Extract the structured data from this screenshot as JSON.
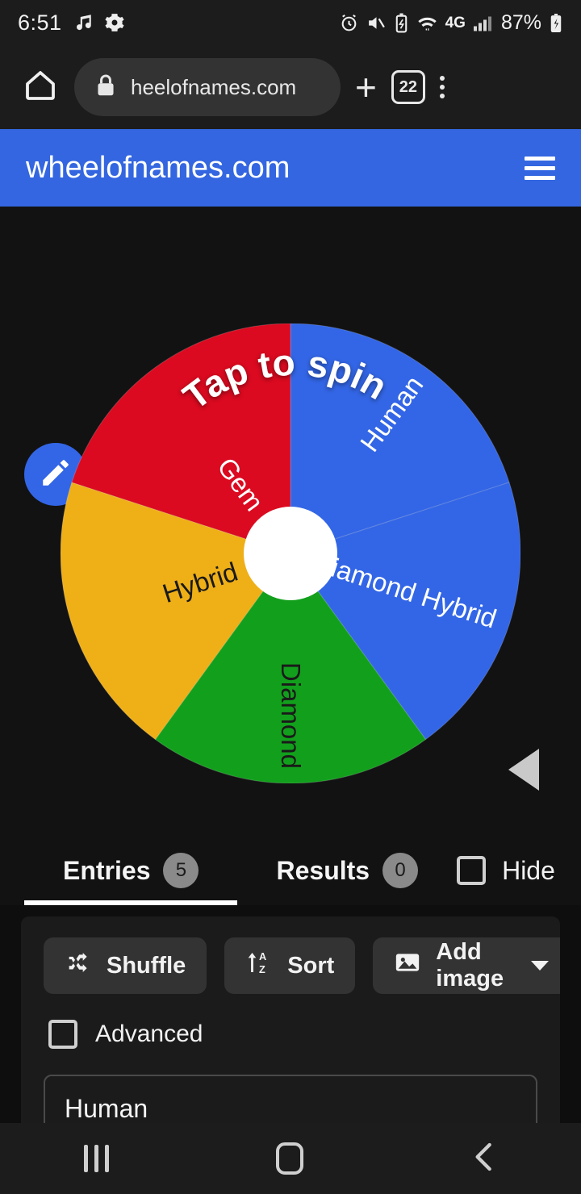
{
  "statusbar": {
    "time": "6:51",
    "battery_percent": "87%",
    "network": "4G",
    "network_sup": "+",
    "icons": [
      "music-note-icon",
      "settings-gear-icon",
      "alarm-icon",
      "mute-icon",
      "battery-saver-icon",
      "wifi-icon",
      "network-4g-icon",
      "signal-bars-icon",
      "battery-charging-icon"
    ]
  },
  "browserbar": {
    "url": "heelofnames.com",
    "tab_count": "22",
    "icons": [
      "home-icon",
      "lock-icon",
      "new-tab-plus-icon",
      "tab-switcher-icon",
      "overflow-menu-icon"
    ]
  },
  "appheader": {
    "title": "wheelofnames.com",
    "menu_icon": "hamburger-menu-icon",
    "brand_color": "#3366E0"
  },
  "wheel": {
    "center_text": "Tap to spin",
    "edit_icon": "pencil-edit-icon",
    "pointer_color": "#c9c9c9",
    "hub_color": "#ffffff",
    "segments": [
      {
        "label": "Human",
        "color": "#3366E6",
        "text_color": "#ffffff"
      },
      {
        "label": "Diamond Hybrid",
        "color": "#3366E6",
        "text_color": "#ffffff"
      },
      {
        "label": "Diamond",
        "color": "#12A01C",
        "text_color": "#1a1a1a"
      },
      {
        "label": "Hybrid",
        "color": "#EFAF17",
        "text_color": "#1a1a1a"
      },
      {
        "label": "Gem",
        "color": "#DB0A20",
        "text_color": "#ffffff"
      }
    ]
  },
  "tabs": {
    "entries": {
      "label": "Entries",
      "count": "5"
    },
    "results": {
      "label": "Results",
      "count": "0"
    },
    "hide": {
      "label": "Hide",
      "checked": false
    }
  },
  "panel": {
    "shuffle_label": "Shuffle",
    "sort_label": "Sort",
    "add_image_label": "Add image",
    "advanced_label": "Advanced",
    "entry_text": "Human",
    "icons": [
      "shuffle-icon",
      "sort-az-icon",
      "image-icon",
      "chevron-down-icon"
    ]
  },
  "navbar": {
    "icons": [
      "recents-icon",
      "home-icon",
      "back-icon"
    ]
  }
}
